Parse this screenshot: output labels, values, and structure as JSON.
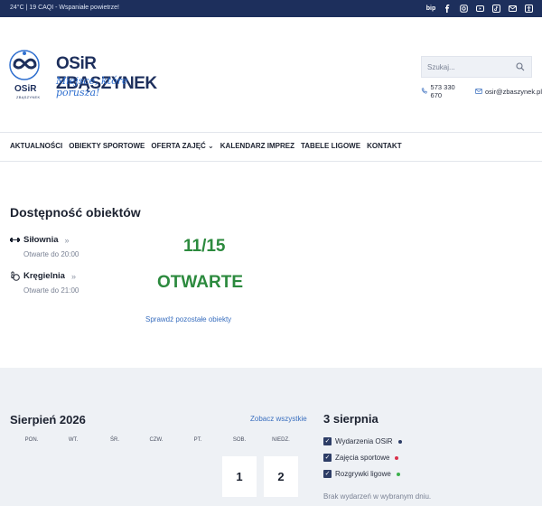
{
  "topbar": {
    "weather": "24°C | 19 CAQI - Wspaniałe powietrze!",
    "social": {
      "bip": "bip"
    }
  },
  "header": {
    "logo_name": "OSiR ZBĄSZYNEK",
    "logo_slogan": "Miejsce, które porusza!",
    "logo_osir": "OSiR",
    "logo_sub": "ZBĄSZYNEK",
    "search_placeholder": "Szukaj...",
    "phone": "573 330 670",
    "email": "osir@zbaszynek.pl"
  },
  "nav": {
    "items": [
      "AKTUALNOŚCI",
      "OBIEKTY SPORTOWE",
      "OFERTA ZAJĘĆ ⌄",
      "KALENDARZ IMPREZ",
      "TABELE LIGOWE",
      "KONTAKT"
    ]
  },
  "availability": {
    "title": "Dostępność obiektów",
    "facilities": [
      {
        "name": "Siłownia",
        "hours": "Otwarte do 20:00",
        "value": "11/15"
      },
      {
        "name": "Kręgielnia",
        "hours": "Otwarte do 21:00",
        "value": "OTWARTE"
      }
    ],
    "more_link": "Sprawdź pozostałe obiekty"
  },
  "calendar": {
    "title": "Sierpień 2026",
    "see_all": "Zobacz wszystkie",
    "weekdays": [
      "PON.",
      "WT.",
      "ŚR.",
      "CZW.",
      "PT.",
      "SOB.",
      "NIEDZ."
    ],
    "days": [
      "1",
      "2"
    ]
  },
  "events": {
    "date_title": "3 sierpnia",
    "filters": [
      {
        "label": "Wydarzenia OSiR",
        "color": "#2d3d66"
      },
      {
        "label": "Zajęcia sportowe",
        "color": "#d9304a"
      },
      {
        "label": "Rozgrywki ligowe",
        "color": "#3cb04b"
      }
    ],
    "empty": "Brak wydarzeń w wybranym dniu."
  },
  "colors": {
    "topbar": "#1d2f5c",
    "accent_green": "#2c8a3e",
    "link_blue": "#3a6fbf"
  }
}
